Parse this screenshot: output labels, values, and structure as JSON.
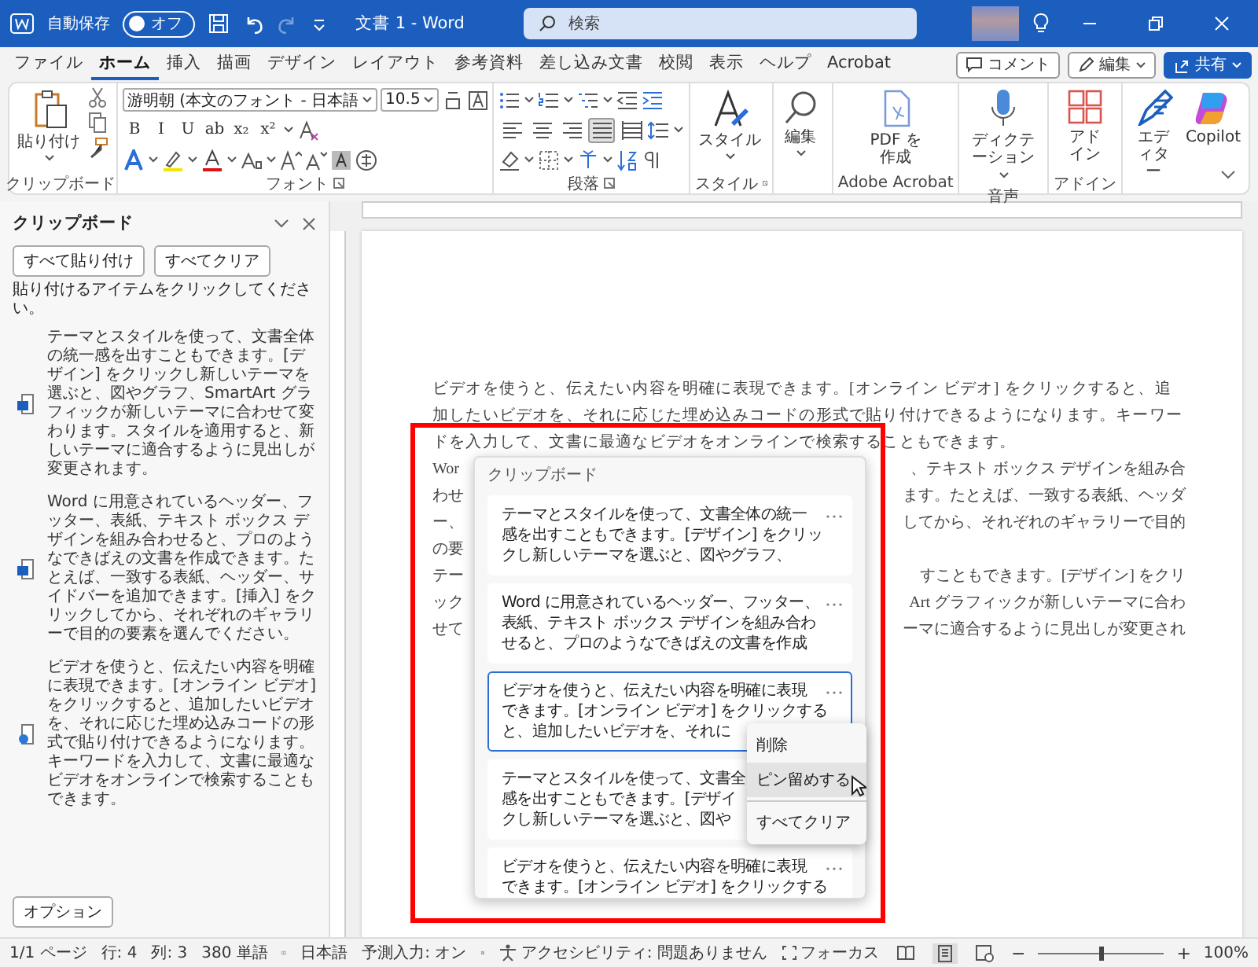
{
  "title_bar": {
    "autosave_label": "自動保存",
    "autosave": {
      "on": false,
      "state_label": "オフ"
    },
    "quick_access": [
      {
        "kind": "save",
        "disabled": false
      },
      {
        "kind": "undo",
        "disabled": false
      },
      {
        "kind": "redo",
        "disabled": true
      },
      {
        "kind": "customize",
        "disabled": false
      }
    ],
    "title": "文書 1 - Word",
    "search": {
      "placeholder": "検索"
    }
  },
  "tabs": [
    {
      "label": "ファイル",
      "selected": false
    },
    {
      "label": "ホーム",
      "selected": true
    },
    {
      "label": "挿入",
      "selected": false
    },
    {
      "label": "描画",
      "selected": false
    },
    {
      "label": "デザイン",
      "selected": false
    },
    {
      "label": "レイアウト",
      "selected": false
    },
    {
      "label": "参考資料",
      "selected": false
    },
    {
      "label": "差し込み文書",
      "selected": false
    },
    {
      "label": "校閲",
      "selected": false
    },
    {
      "label": "表示",
      "selected": false
    },
    {
      "label": "ヘルプ",
      "selected": false
    },
    {
      "label": "Acrobat",
      "selected": false
    }
  ],
  "tab_actions": {
    "comment": "コメント",
    "edit": "編集",
    "share": "共有"
  },
  "ribbon": {
    "clipboard": {
      "paste": "貼り付け",
      "label": "クリップボード"
    },
    "font": {
      "name": "游明朝 (本文のフォント - 日本語",
      "size": "10.5",
      "format_buttons": [
        "B",
        "I",
        "U",
        "ab",
        "x₂",
        "x²"
      ],
      "label": "フォント"
    },
    "paragraph": {
      "align_buttons": [
        {
          "kind": "left",
          "selected": false
        },
        {
          "kind": "center",
          "selected": false
        },
        {
          "kind": "right",
          "selected": false
        },
        {
          "kind": "justify",
          "selected": true
        },
        {
          "kind": "distributed",
          "selected": false
        }
      ],
      "label": "段落"
    },
    "styles": {
      "button": "スタイル",
      "label": "スタイル"
    },
    "editing": {
      "button": "編集"
    },
    "acrobat": {
      "button": "PDF を作成",
      "label": "Adobe Acrobat"
    },
    "voice": {
      "button": "ディクテーション",
      "label": "音声"
    },
    "addins": {
      "button": "アドイン",
      "label": "アドイン"
    },
    "editor": {
      "button": "エディター"
    },
    "copilot": {
      "button": "Copilot"
    }
  },
  "clipboard_pane": {
    "title": "クリップボード",
    "buttons": [
      "すべて貼り付け",
      "すべてクリア"
    ],
    "instruction": "貼り付けるアイテムをクリックしてください。",
    "items": [
      {
        "kind": "document",
        "text": "テーマとスタイルを使って、文書全体の統一感を出すこともできます。[デザイン] をクリックし新しいテーマを選ぶと、図やグラフ、SmartArt グラフィックが新しいテーマに合わせて変わります。スタイルを適用すると、新しいテーマに適合するように見出しが変更されます。"
      },
      {
        "kind": "document",
        "text": "Word に用意されているヘッダー、フッター、表紙、テキスト ボックス デザインを組み合わせると、プロのようなできばえの文書を作成できます。たとえば、一致する表紙、ヘッダー、サイドバーを追加できます。[挿入] をクリックしてから、それぞれのギャラリーで目的の要素を選んでください。"
      },
      {
        "kind": "web",
        "text": "ビデオを使うと、伝えたい内容を明確に表現できます。[オンライン ビデオ] をクリックすると、追加したいビデオを、それに応じた埋め込みコードの形式で貼り付けできるようになります。キーワードを入力して、文書に最適なビデオをオンラインで検索することもできます。"
      }
    ],
    "options": "オプション"
  },
  "document": {
    "paragraph": "ビデオを使うと、伝えたい内容を明確に表現できます。[オンライン ビデオ] をクリックすると、追加したいビデオを、それに応じた埋め込みコードの形式で貼り付けできるようになります。キーワードを入力して、文書に最適なビデオをオンラインで検索することもできます。",
    "fragments": [
      {
        "left": "Wor",
        "right": "、テキスト ボックス デザインを組み合"
      },
      {
        "left": "わせ",
        "right": "ます。たとえば、一致する表紙、ヘッダ"
      },
      {
        "left": "ー、",
        "right": "してから、それぞれのギャラリーで目的"
      },
      {
        "left": "の要"
      },
      {
        "left": "テー",
        "right": "すこともできます。[デザイン] をクリ"
      },
      {
        "left": "ック",
        "right": "Art グラフィックが新しいテーマに合わ"
      },
      {
        "left": "せて",
        "right": "ーマに適合するように見出しが変更され"
      }
    ]
  },
  "clipboard_popup": {
    "title": "クリップボード",
    "items": [
      {
        "lines": [
          "テーマとスタイルを使って、文書全体の統一",
          "感を出すこともできます。[デザイン] をクリッ",
          "クし新しいテーマを選ぶと、図やグラフ、"
        ],
        "selected": false
      },
      {
        "lines": [
          "Word に用意されているヘッダー、フッター、",
          "表紙、テキスト ボックス デザインを組み合わ",
          "せると、プロのようなできばえの文書を作成"
        ],
        "selected": false
      },
      {
        "lines": [
          "ビデオを使うと、伝えたい内容を明確に表現",
          "できます。[オンライン ビデオ] をクリックする",
          "と、追加したいビデオを、それに"
        ],
        "selected": true
      },
      {
        "lines": [
          "テーマとスタイルを使って、文書全",
          "感を出すこともできます。[デザイ",
          "クし新しいテーマを選ぶと、図や"
        ],
        "selected": false
      },
      {
        "lines": [
          "ビデオを使うと、伝えたい内容を明確に表現",
          "できます。[オンライン ビデオ] をクリックする"
        ],
        "selected": false
      }
    ],
    "menu": [
      {
        "label": "削除",
        "selected": false,
        "separator_after": false
      },
      {
        "label": "ピン留めする",
        "selected": true,
        "separator_after": true
      },
      {
        "label": "すべてクリア",
        "selected": false,
        "separator_after": false
      }
    ]
  },
  "status_bar": {
    "page": "1/1 ページ",
    "line": "行: 4",
    "column": "列: 3",
    "words": "380 単語",
    "language": "日本語",
    "ime": "予測入力: オン",
    "accessibility": "アクセシビリティ: 問題ありません",
    "focus": "フォーカス",
    "zoom_out": "−",
    "zoom": {
      "level": 0.5
    },
    "zoom_in": "+",
    "zoom_percent": "100%"
  }
}
